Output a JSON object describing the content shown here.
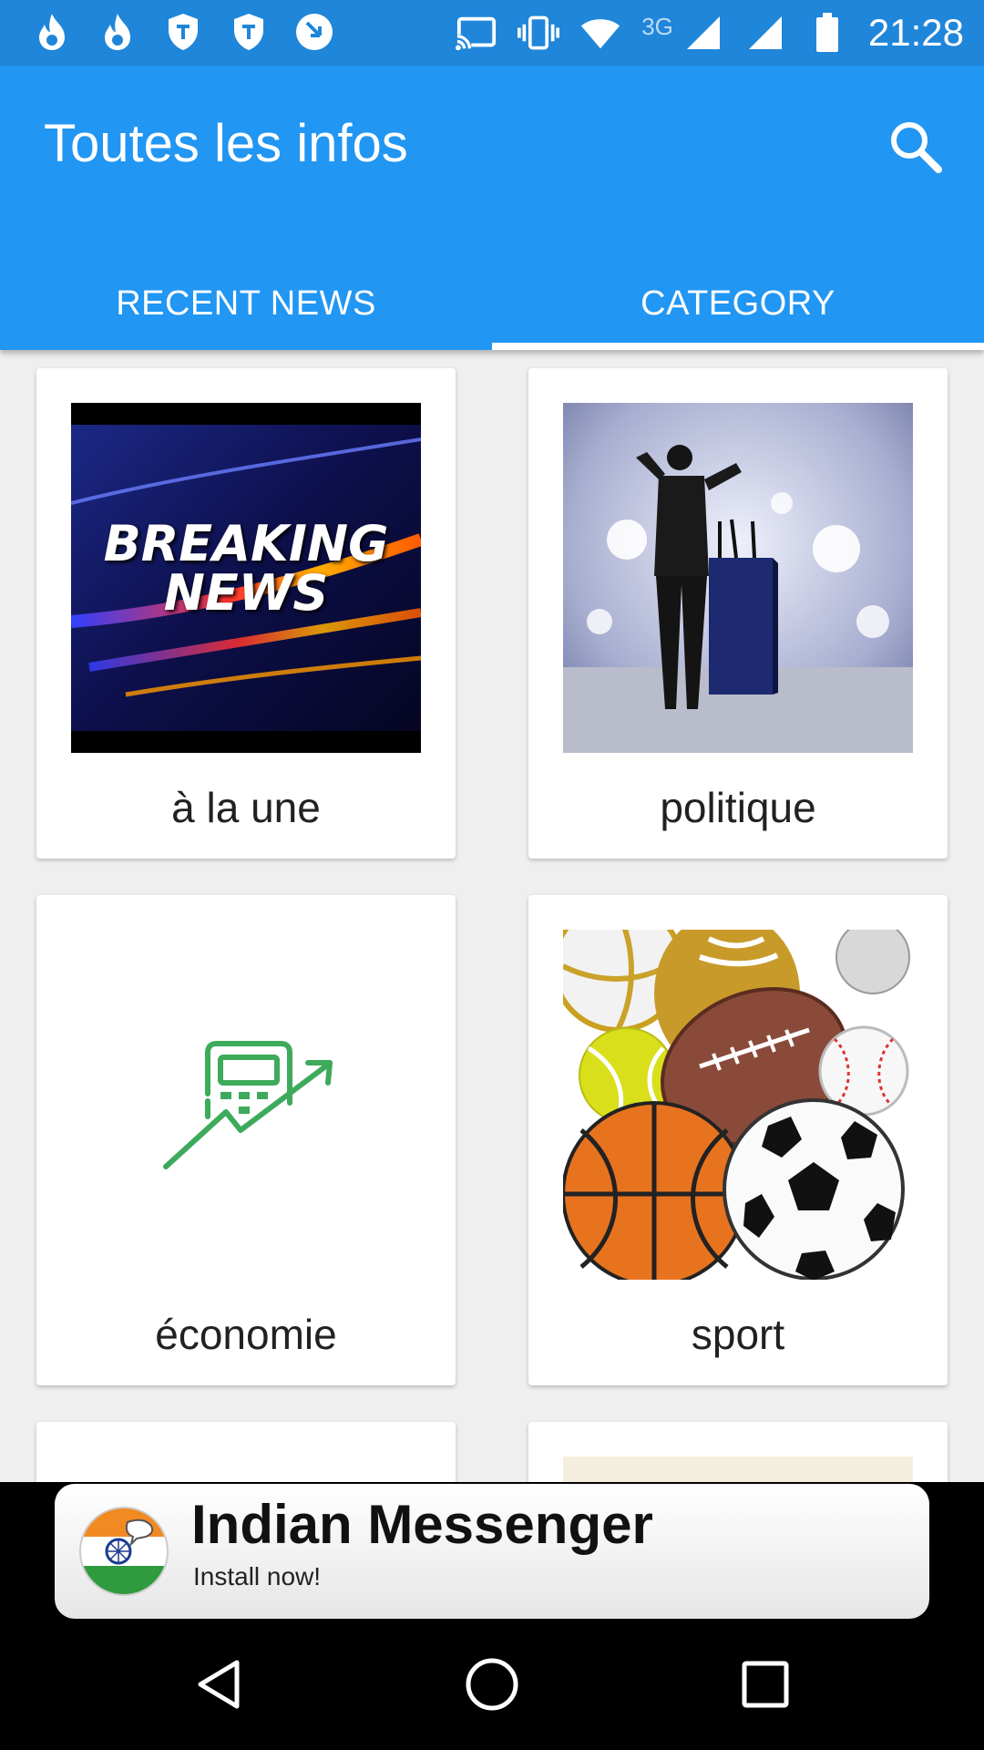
{
  "status_bar": {
    "time": "21:28",
    "network_label": "3G",
    "left_icons": [
      "flame-icon",
      "flame-icon",
      "shield-icon",
      "shield-icon",
      "sync-arrow-icon"
    ],
    "right_icons": [
      "cast-icon",
      "vibrate-icon",
      "wifi-icon",
      "signal-icon",
      "signal-icon",
      "battery-icon"
    ]
  },
  "app_bar": {
    "title": "Toutes les infos",
    "search_icon": "search-icon",
    "color": "#2196f3"
  },
  "tabs": [
    {
      "label": "RECENT NEWS",
      "selected": false
    },
    {
      "label": "CATEGORY",
      "selected": true
    }
  ],
  "categories": [
    {
      "label": "à la une",
      "image": "breaking-news",
      "image_text": [
        "BREAKING",
        "NEWS"
      ]
    },
    {
      "label": "politique",
      "image": "politician-podium"
    },
    {
      "label": "économie",
      "image": "economy-calculator-icon"
    },
    {
      "label": "sport",
      "image": "sports-balls"
    }
  ],
  "ad": {
    "title": "Indian Messenger",
    "subtitle": "Install now!",
    "logo": "indian-flag-chat-icon"
  },
  "nav": [
    "back-icon",
    "home-icon",
    "recents-icon"
  ]
}
